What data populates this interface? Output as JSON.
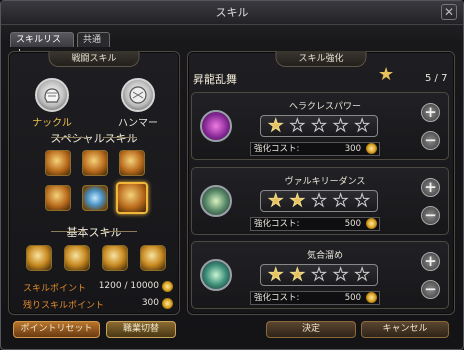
{
  "window": {
    "title": "スキル"
  },
  "tabs": [
    "スキルリスト",
    "共通"
  ],
  "left_panel": {
    "header": "戦闘スキル",
    "weapons": [
      {
        "label": "ナックル",
        "icon": "knuckle-icon",
        "active": true
      },
      {
        "label": "ハンマー",
        "icon": "hammer-icon",
        "active": false
      }
    ],
    "special_title": "スペシャルスキル",
    "special_skills": [
      "skill-slash-icon",
      "skill-burst-icon",
      "skill-claw-icon",
      "skill-flame-icon",
      "skill-orb-icon",
      "skill-whirl-icon"
    ],
    "basic_title": "基本スキル",
    "basic_skills": [
      "skill-strike-icon",
      "skill-uppercut-icon",
      "skill-rush-icon",
      "skill-spin-icon"
    ],
    "skill_points_label": "スキルポイント",
    "skill_points_value": "1200 / 10000",
    "remaining_points_label": "残りスキルポイント",
    "remaining_points_value": "300",
    "reset_button": "ポイントリセット",
    "job_button": "職業切替"
  },
  "right_panel": {
    "header": "スキル強化",
    "skill_name": "昇龍乱舞",
    "rank": "5 / 7",
    "enhancements": [
      {
        "name": "ヘラクレスパワー",
        "stars_filled": 1,
        "stars_total": 5,
        "cost_label": "強化コスト:",
        "cost": "300",
        "icon": "heracles-power-icon"
      },
      {
        "name": "ヴァルキリーダンス",
        "stars_filled": 2,
        "stars_total": 5,
        "cost_label": "強化コスト:",
        "cost": "500",
        "icon": "valkyrie-dance-icon"
      },
      {
        "name": "気合溜め",
        "stars_filled": 2,
        "stars_total": 5,
        "cost_label": "強化コスト:",
        "cost": "500",
        "icon": "focus-charge-icon"
      }
    ],
    "confirm_button": "決定",
    "cancel_button": "キャンセル"
  },
  "colors": {
    "accent_gold": "#e7c25c",
    "points_orange": "#e08a2c"
  }
}
